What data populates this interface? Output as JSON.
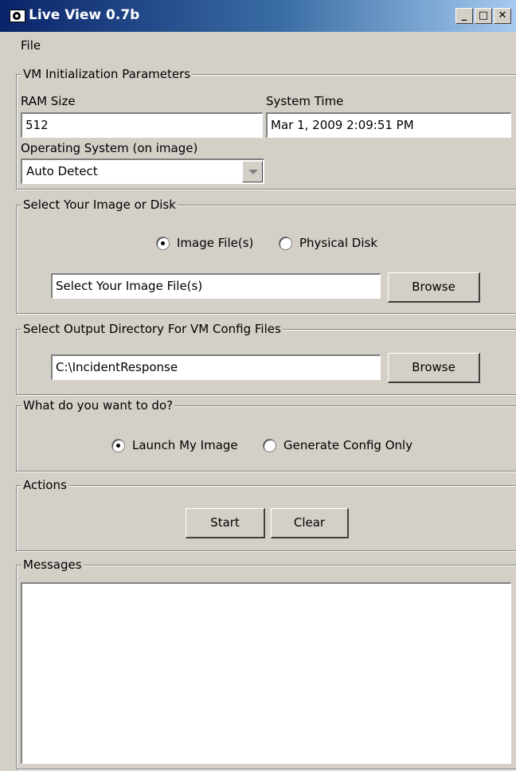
{
  "window": {
    "title": "Live View 0.7b"
  },
  "menu": {
    "file": "File"
  },
  "vm_params": {
    "legend": "VM Initialization Parameters",
    "ram_label": "RAM Size",
    "ram_value": "512",
    "time_label": "System Time",
    "time_value": "Mar 1, 2009 2:09:51 PM",
    "os_label": "Operating System (on image)",
    "os_value": "Auto Detect"
  },
  "image_select": {
    "legend": "Select Your Image or Disk",
    "radio_image": "Image File(s)",
    "radio_disk": "Physical Disk",
    "selected": "Image File(s)",
    "path_value": "Select Your Image File(s)",
    "browse": "Browse"
  },
  "output_dir": {
    "legend": "Select Output Directory For VM Config Files",
    "path_value": "C:\\IncidentResponse",
    "browse": "Browse"
  },
  "task": {
    "legend": "What do you want to do?",
    "radio_launch": "Launch My Image",
    "radio_generate": "Generate Config Only",
    "selected": "Launch My Image"
  },
  "actions": {
    "legend": "Actions",
    "start": "Start",
    "clear": "Clear"
  },
  "messages": {
    "legend": "Messages",
    "content": ""
  }
}
